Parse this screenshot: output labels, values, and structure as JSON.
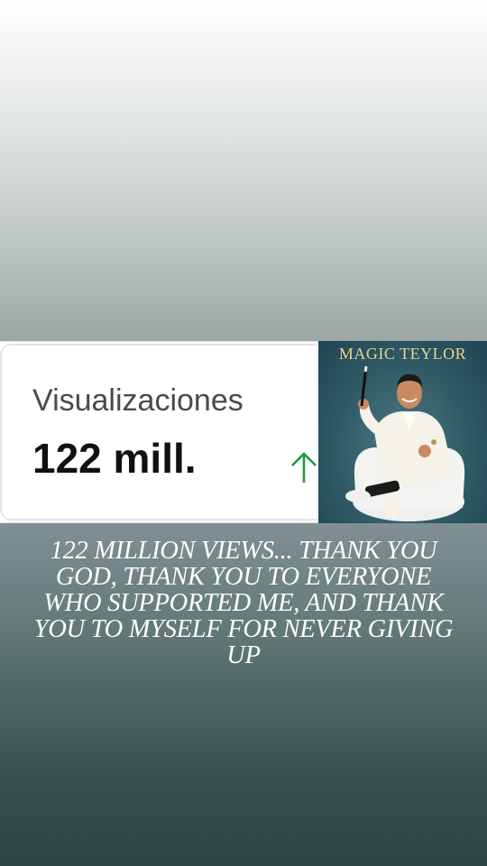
{
  "stat": {
    "label": "Visualizaciones",
    "value": "122 mill.",
    "trend_icon": "arrow-up-icon",
    "trend_color": "#1e9b3a"
  },
  "poster": {
    "title": "MAGIC TEYLOR",
    "title_color": "#e9d48f"
  },
  "caption": "122 MILLION VIEWS... THANK YOU GOD, THANK YOU TO EVERYONE WHO SUPPORTED ME, AND THANK YOU TO MYSELF FOR NEVER GIVING UP"
}
